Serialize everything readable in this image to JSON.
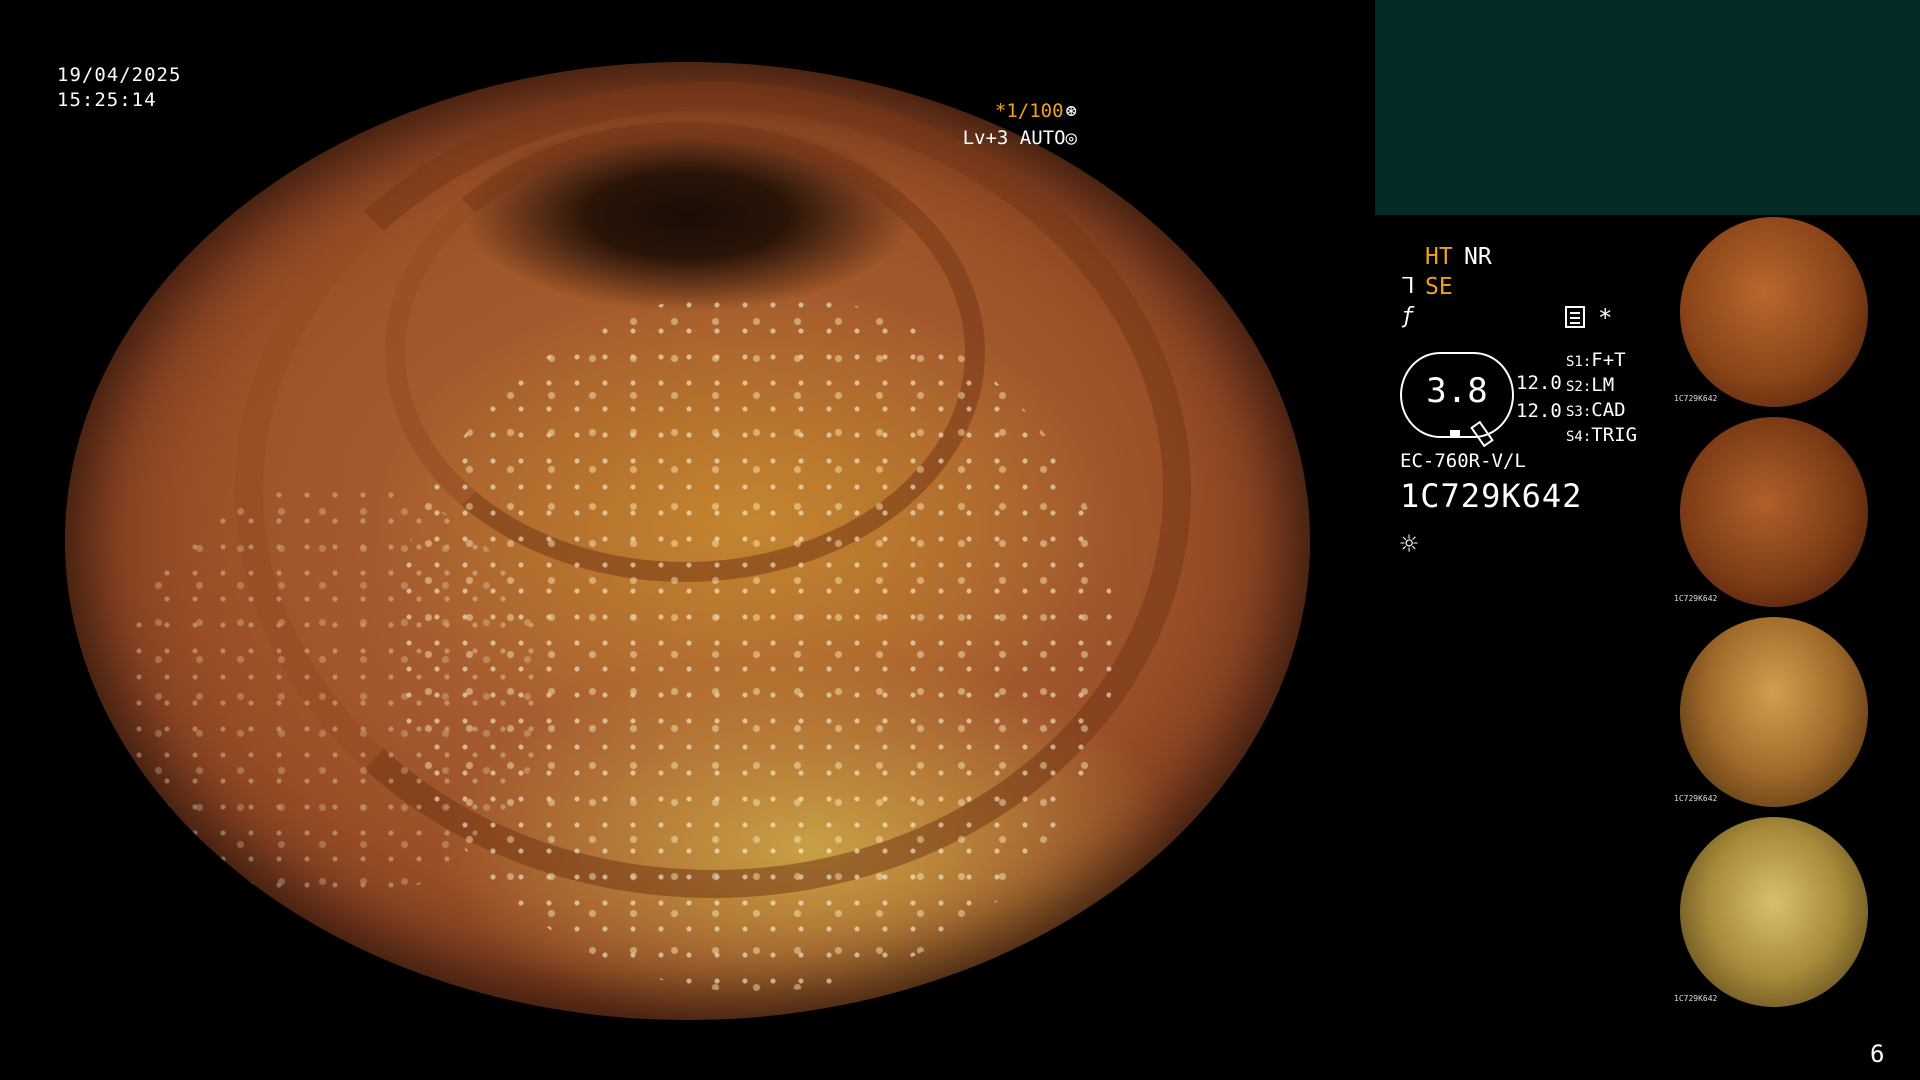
{
  "overlay": {
    "date": "19/04/2025",
    "time": "15:25:14",
    "shutter": "*1/100",
    "shutter_icon": "⊛",
    "level": "Lv+3 AUTO",
    "level_icon": "◎"
  },
  "panel": {
    "ht_label": "HT",
    "nr_label": "NR",
    "se_label": "SE",
    "se_icon": "ᒣ",
    "f_icon": "ƒ",
    "asterisk": "*",
    "pressure_value": "3.8",
    "values": [
      "12.0",
      "12.0"
    ],
    "switches": [
      {
        "key": "S1:",
        "label": "F+T"
      },
      {
        "key": "S2:",
        "label": "LM"
      },
      {
        "key": "S3:",
        "label": "CAD"
      },
      {
        "key": "S4:",
        "label": "TRIG"
      }
    ],
    "model": "EC-760R-V/L",
    "serial": "1C729K642",
    "light_icon": "☼"
  },
  "thumbnails": [
    {
      "caption": "1C729K642"
    },
    {
      "caption": "1C729K642"
    },
    {
      "caption": "1C729K642"
    },
    {
      "caption": "1C729K642"
    }
  ],
  "page_number": "6",
  "colors": {
    "accent": "#f0a020",
    "header_panel": "#032a25"
  }
}
